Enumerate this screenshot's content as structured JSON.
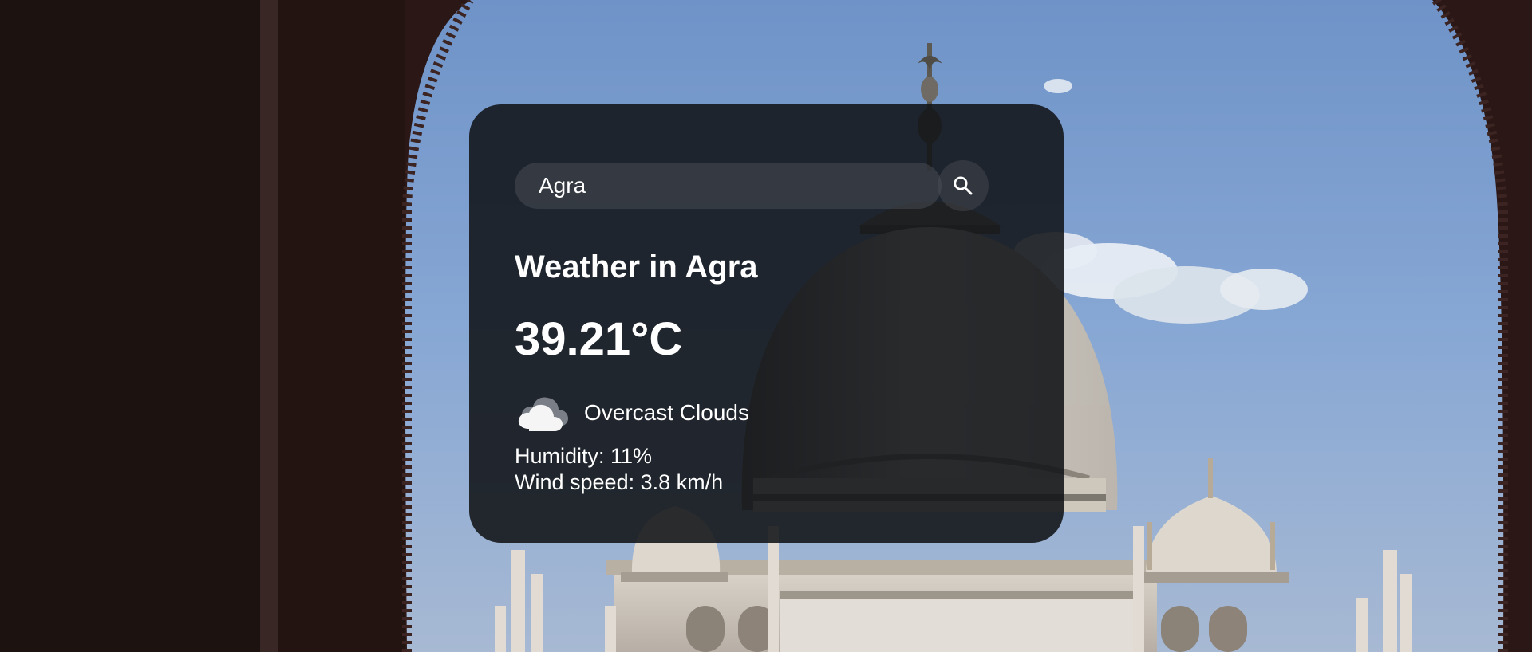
{
  "search": {
    "value": "Agra",
    "button_icon": "search-icon"
  },
  "weather": {
    "title": "Weather in Agra",
    "temperature": "39.21°C",
    "icon": "cloud-icon",
    "description": "Overcast Clouds",
    "humidity": "Humidity: 11%",
    "wind": "Wind speed: 3.8 km/h"
  },
  "colors": {
    "card_background": "#111317",
    "text": "#ffffff",
    "search_field": "#4e5259",
    "sky": "#7f9fd1"
  }
}
